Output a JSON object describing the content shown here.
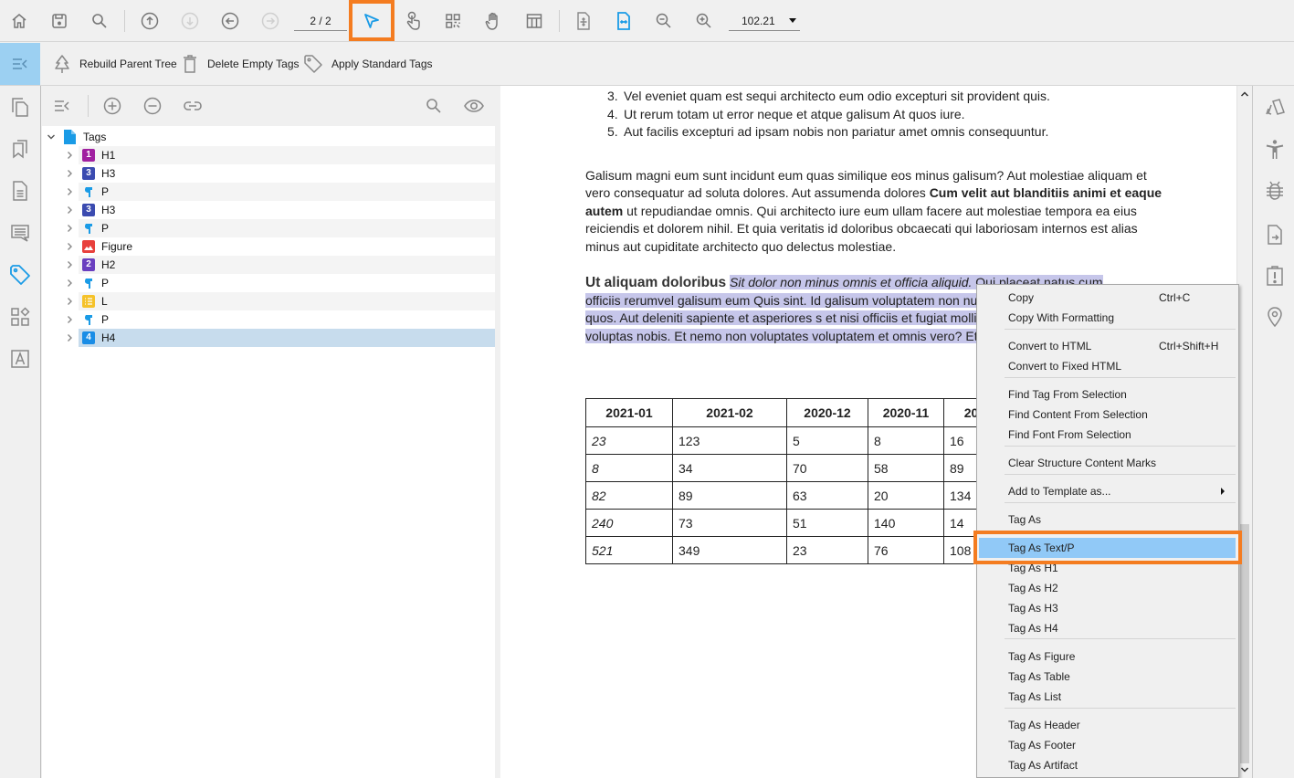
{
  "toolbar": {
    "page_indicator": "2 / 2",
    "zoom_value": "102.21",
    "buttons": [
      {
        "name": "home",
        "icon": "home-icon"
      },
      {
        "name": "save",
        "icon": "save-icon"
      },
      {
        "name": "search",
        "icon": "search-icon"
      },
      {
        "name": "previous-page",
        "icon": "arrow-up-circle-icon"
      },
      {
        "name": "next-page",
        "icon": "arrow-down-circle-icon",
        "disabled": true
      },
      {
        "name": "back",
        "icon": "arrow-left-circle-icon"
      },
      {
        "name": "forward",
        "icon": "arrow-right-circle-icon",
        "disabled": true
      },
      {
        "name": "select-tool",
        "icon": "cursor-arrow-icon",
        "active": true
      },
      {
        "name": "touch-tool",
        "icon": "hand-pointer-icon"
      },
      {
        "name": "qr-tool",
        "icon": "qr-code-icon"
      },
      {
        "name": "pan-tool",
        "icon": "hand-icon"
      },
      {
        "name": "table-tool",
        "icon": "table-icon"
      },
      {
        "name": "fit-page",
        "icon": "fit-page-icon"
      },
      {
        "name": "fit-width",
        "icon": "fit-width-icon",
        "active": true
      },
      {
        "name": "zoom-out",
        "icon": "zoom-out-icon"
      },
      {
        "name": "zoom-in",
        "icon": "zoom-in-icon"
      }
    ]
  },
  "toolbar2": {
    "items": [
      {
        "label": "Rebuild Parent Tree",
        "icon": "tree-icon"
      },
      {
        "label": "Delete Empty Tags",
        "icon": "trash-icon"
      },
      {
        "label": "Apply Standard Tags",
        "icon": "tag-icon"
      }
    ]
  },
  "left_rail": {
    "items": [
      {
        "name": "pages",
        "icon": "pages-icon"
      },
      {
        "name": "bookmarks",
        "icon": "bookmark-icon"
      },
      {
        "name": "document",
        "icon": "document-icon"
      },
      {
        "name": "comments",
        "icon": "comment-icon"
      },
      {
        "name": "tags",
        "icon": "tag-icon",
        "active": true
      },
      {
        "name": "content",
        "icon": "shapes-icon"
      },
      {
        "name": "fonts",
        "icon": "font-icon"
      }
    ]
  },
  "tags_panel": {
    "root": "Tags",
    "items": [
      {
        "label": "H1",
        "badge": "1",
        "color": "#a020a0",
        "type": "heading"
      },
      {
        "label": "H3",
        "badge": "3",
        "color": "#3b4bb0",
        "type": "heading"
      },
      {
        "label": "P",
        "badge": "",
        "color": "#1a9be6",
        "type": "paragraph"
      },
      {
        "label": "H3",
        "badge": "3",
        "color": "#3b4bb0",
        "type": "heading"
      },
      {
        "label": "P",
        "badge": "",
        "color": "#1a9be6",
        "type": "paragraph"
      },
      {
        "label": "Figure",
        "badge": "",
        "color": "#e8403c",
        "type": "figure"
      },
      {
        "label": "H2",
        "badge": "2",
        "color": "#6a3fbf",
        "type": "heading"
      },
      {
        "label": "P",
        "badge": "",
        "color": "#1a9be6",
        "type": "paragraph"
      },
      {
        "label": "L",
        "badge": "",
        "color": "#f5c22a",
        "type": "list"
      },
      {
        "label": "P",
        "badge": "",
        "color": "#1a9be6",
        "type": "paragraph"
      },
      {
        "label": "H4",
        "badge": "4",
        "color": "#1a8de6",
        "type": "heading",
        "selected": true
      }
    ]
  },
  "document": {
    "list_items": [
      {
        "num": "3.",
        "text": "Vel eveniet quam est sequi architecto eum odio excepturi sit provident quis."
      },
      {
        "num": "4.",
        "text": "Ut rerum totam ut error neque et atque galisum At quos iure."
      },
      {
        "num": "5.",
        "text": "Aut facilis excepturi ad ipsam nobis non pariatur amet omnis consequuntur."
      }
    ],
    "paragraph": {
      "part1": "Galisum magni eum sunt incidunt eum quas similique eos minus galisum? Aut molestiae aliquam et vero consequatur ad soluta dolores. Aut assumenda dolores ",
      "bold": "Cum velit aut blanditiis animi et eaque autem",
      "part2": " ut repudiandae omnis. Qui architecto iure eum ullam facere aut molestiae tempora ea eius reiciendis et dolorem nihil. Et quia veritatis id doloribus obcaecati qui laboriosam internos est alias minus aut cupiditate architecto quo delectus molestiae."
    },
    "heading_paragraph": {
      "heading": "Ut aliquam doloribus",
      "italic": "Sit dolor non minus omnis et officia aliquid.",
      "rest": " Qui placeat natus cum officiis rerumvel galisum eum Quis sint. Id galisum voluptatem non numquam illum qui quia quos. Aut deleniti sapiente et asperiores s et nisi officiis et fugiat mollitia qui enim quae est voluptas nobis. Et nemo non voluptates voluptatem et omnis vero? Et tempora tenet"
    },
    "table": {
      "headers": [
        "2021-01",
        "2021-02",
        "2020-12",
        "2020-11",
        "20"
      ],
      "rows": [
        [
          "23",
          "123",
          "5",
          "8",
          "16"
        ],
        [
          "8",
          "34",
          "70",
          "58",
          "89"
        ],
        [
          "82",
          "89",
          "63",
          "20",
          "134"
        ],
        [
          "240",
          "73",
          "51",
          "140",
          "14"
        ],
        [
          "521",
          "349",
          "23",
          "76",
          "108"
        ]
      ]
    }
  },
  "right_rail": {
    "items": [
      {
        "name": "cards",
        "icon": "cards-icon"
      },
      {
        "name": "accessibility",
        "icon": "accessibility-icon"
      },
      {
        "name": "debug",
        "icon": "bug-icon"
      },
      {
        "name": "export",
        "icon": "export-file-icon"
      },
      {
        "name": "alerts",
        "icon": "alert-clipboard-icon"
      },
      {
        "name": "location",
        "icon": "location-pin-icon"
      }
    ]
  },
  "context_menu": {
    "items": [
      {
        "label": "Copy",
        "shortcut": "Ctrl+C"
      },
      {
        "label": "Copy With Formatting",
        "shortcut": ""
      },
      {
        "label": "Convert to HTML",
        "shortcut": "Ctrl+Shift+H"
      },
      {
        "label": "Convert to Fixed HTML",
        "shortcut": ""
      },
      {
        "label": "Find Tag From Selection",
        "shortcut": ""
      },
      {
        "label": "Find Content From Selection",
        "shortcut": ""
      },
      {
        "label": "Find Font From Selection",
        "shortcut": ""
      },
      {
        "label": "Clear Structure Content Marks",
        "shortcut": ""
      },
      {
        "label": "Add to Template as...",
        "shortcut": "",
        "submenu": true
      },
      {
        "label": "Tag As",
        "shortcut": ""
      },
      {
        "label": "Tag As Text/P",
        "shortcut": "",
        "highlighted": true
      },
      {
        "label": "Tag As H1",
        "shortcut": ""
      },
      {
        "label": "Tag As H2",
        "shortcut": ""
      },
      {
        "label": "Tag As H3",
        "shortcut": ""
      },
      {
        "label": "Tag As H4",
        "shortcut": ""
      },
      {
        "label": "Tag As Figure",
        "shortcut": ""
      },
      {
        "label": "Tag As Table",
        "shortcut": ""
      },
      {
        "label": "Tag As List",
        "shortcut": ""
      },
      {
        "label": "Tag As Header",
        "shortcut": ""
      },
      {
        "label": "Tag As Footer",
        "shortcut": ""
      },
      {
        "label": "Tag As Artifact",
        "shortcut": ""
      }
    ]
  },
  "colors": {
    "accent": "#1a9be6",
    "highlight_box": "#f47c20",
    "menu_highlight": "#91c9f7",
    "selection": "#c6c6ea",
    "selected_row": "#c7dced"
  }
}
